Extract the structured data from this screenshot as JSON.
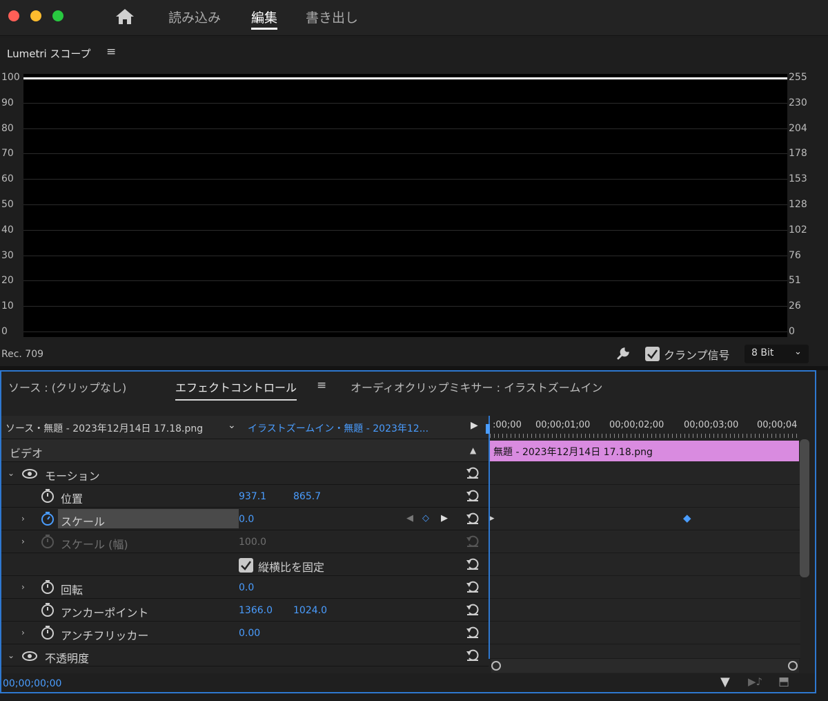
{
  "window": {
    "lights": [
      "#ff5f57",
      "#febc2e",
      "#28c840"
    ]
  },
  "nav": {
    "home_icon": "home-icon",
    "tabs": [
      "読み込み",
      "編集",
      "書き出し"
    ],
    "active": "編集"
  },
  "scope": {
    "title": "Lumetri スコープ",
    "menu_icon": "hamburger-icon",
    "left_axis": [
      "100",
      "90",
      "80",
      "70",
      "60",
      "50",
      "40",
      "30",
      "20",
      "10",
      "0"
    ],
    "right_axis": [
      "255",
      "230",
      "204",
      "178",
      "153",
      "128",
      "102",
      "76",
      "51",
      "26",
      "0"
    ],
    "colorspace": "Rec. 709",
    "clamp_label": "クランプ信号",
    "clamp_checked": true,
    "bit_depth": "8 Bit"
  },
  "panel_tabs": {
    "source": "ソース : (クリップなし)",
    "effect": "エフェクトコントロール",
    "mixer": "オーディオクリップミキサー : イラストズームイン"
  },
  "effect": {
    "source_clip": "ソース・無題 - 2023年12月14日 17.18.png",
    "sequence_clip": "イラストズームイン・無題 - 2023年12...",
    "section": "ビデオ",
    "motion": "モーション",
    "properties": {
      "position": {
        "label": "位置",
        "x": "937.1",
        "y": "865.7"
      },
      "scale": {
        "label": "スケール",
        "value": "0.0"
      },
      "scale_width": {
        "label": "スケール (幅)",
        "value": "100.0"
      },
      "uniform": {
        "label": "縦横比を固定",
        "checked": true
      },
      "rotation": {
        "label": "回転",
        "value": "0.0"
      },
      "anchor": {
        "label": "アンカーポイント",
        "x": "1366.0",
        "y": "1024.0"
      },
      "flicker": {
        "label": "アンチフリッカー",
        "value": "0.00"
      }
    },
    "opacity": "不透明度",
    "timecode": "00;00;00;00"
  },
  "timeline": {
    "ruler": [
      ":00;00",
      "00;00;01;00",
      "00;00;02;00",
      "00;00;03;00",
      "00;00;04"
    ],
    "clip": "無題 - 2023年12月14日 17.18.png",
    "clip_color": "#d98be0"
  }
}
